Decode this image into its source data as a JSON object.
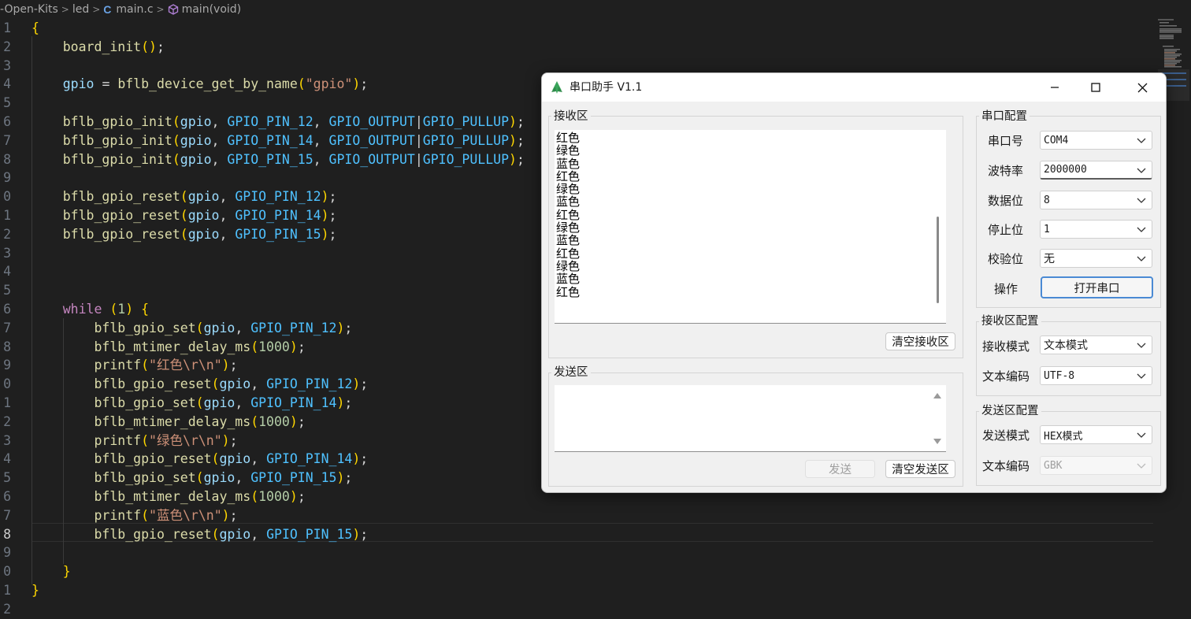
{
  "editor": {
    "breadcrumb": {
      "project": "-Open-Kits",
      "folder": "led",
      "file": "main.c",
      "symbol": "main(void)",
      "file_icon": "c-file-icon",
      "symbol_icon": "cube-icon"
    },
    "line_numbers": [
      "1",
      "2",
      "3",
      "4",
      "5",
      "6",
      "7",
      "8",
      "9",
      "0",
      "1",
      "2",
      "3",
      "4",
      "5",
      "6",
      "7",
      "8",
      "9",
      "0",
      "1",
      "2",
      "3",
      "4",
      "5",
      "6",
      "7",
      "8",
      "9",
      "0",
      "1",
      "2"
    ],
    "active_line_index": 27,
    "lines": [
      {
        "text": "{"
      },
      {
        "text": "    board_init();"
      },
      {
        "text": ""
      },
      {
        "text": "    gpio = bflb_device_get_by_name(\"gpio\");"
      },
      {
        "text": ""
      },
      {
        "text": "    bflb_gpio_init(gpio, GPIO_PIN_12, GPIO_OUTPUT|GPIO_PULLUP);"
      },
      {
        "text": "    bflb_gpio_init(gpio, GPIO_PIN_14, GPIO_OUTPUT|GPIO_PULLUP);"
      },
      {
        "text": "    bflb_gpio_init(gpio, GPIO_PIN_15, GPIO_OUTPUT|GPIO_PULLUP);"
      },
      {
        "text": ""
      },
      {
        "text": "    bflb_gpio_reset(gpio, GPIO_PIN_12);"
      },
      {
        "text": "    bflb_gpio_reset(gpio, GPIO_PIN_14);"
      },
      {
        "text": "    bflb_gpio_reset(gpio, GPIO_PIN_15);"
      },
      {
        "text": ""
      },
      {
        "text": ""
      },
      {
        "text": ""
      },
      {
        "text": "    while (1) {"
      },
      {
        "text": "        bflb_gpio_set(gpio, GPIO_PIN_12);"
      },
      {
        "text": "        bflb_mtimer_delay_ms(1000);"
      },
      {
        "text": "        printf(\"红色\\r\\n\");"
      },
      {
        "text": "        bflb_gpio_reset(gpio, GPIO_PIN_12);"
      },
      {
        "text": "        bflb_gpio_set(gpio, GPIO_PIN_14);"
      },
      {
        "text": "        bflb_mtimer_delay_ms(1000);"
      },
      {
        "text": "        printf(\"绿色\\r\\n\");"
      },
      {
        "text": "        bflb_gpio_reset(gpio, GPIO_PIN_14);"
      },
      {
        "text": "        bflb_gpio_set(gpio, GPIO_PIN_15);"
      },
      {
        "text": "        bflb_mtimer_delay_ms(1000);"
      },
      {
        "text": "        printf(\"蓝色\\r\\n\");"
      },
      {
        "text": "        bflb_gpio_reset(gpio, GPIO_PIN_15);"
      },
      {
        "text": ""
      },
      {
        "text": "    }"
      },
      {
        "text": "}"
      },
      {
        "text": ""
      }
    ],
    "colors": {
      "background": "#1f1f1f",
      "function": "#dcdcaa",
      "variable": "#9cdcfe",
      "macro": "#4fc1ff",
      "string": "#ce9178",
      "number": "#b5cea8",
      "keyword": "#c586c0"
    }
  },
  "dialog": {
    "title": "串口助手 V1.1",
    "app_icon": "green-plant-icon",
    "window_buttons": {
      "minimize": "minimize-icon",
      "maximize": "maximize-icon",
      "close": "close-icon"
    },
    "receive_area": {
      "label": "接收区",
      "lines": [
        "红色",
        "绿色",
        "蓝色",
        "红色",
        "绿色",
        "蓝色",
        "红色",
        "绿色",
        "蓝色",
        "红色",
        "绿色",
        "蓝色",
        "红色"
      ],
      "clear_button": "清空接收区"
    },
    "send_area": {
      "label": "发送区",
      "value": "",
      "send_button": "发送",
      "clear_button": "清空发送区"
    },
    "port_config": {
      "label": "串口配置",
      "port_label": "串口号",
      "port_value": "COM4",
      "baud_label": "波特率",
      "baud_value": "2000000",
      "databits_label": "数据位",
      "databits_value": "8",
      "stopbits_label": "停止位",
      "stopbits_value": "1",
      "parity_label": "校验位",
      "parity_value": "无",
      "action_label": "操作",
      "open_button": "打开串口"
    },
    "receive_config": {
      "label": "接收区配置",
      "mode_label": "接收模式",
      "mode_value": "文本模式",
      "encoding_label": "文本编码",
      "encoding_value": "UTF-8"
    },
    "send_config": {
      "label": "发送区配置",
      "mode_label": "发送模式",
      "mode_value": "HEX模式",
      "encoding_label": "文本编码",
      "encoding_value": "GBK"
    },
    "accent_color": "#4a8ad4"
  }
}
